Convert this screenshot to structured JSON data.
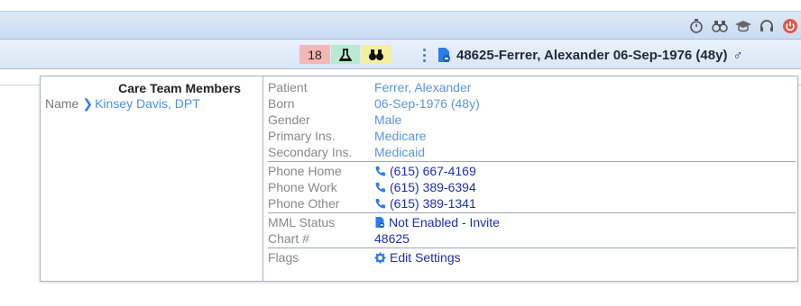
{
  "toolbar": {
    "icons": [
      "stopwatch-icon",
      "binoculars-icon",
      "graduation-cap-icon",
      "headset-icon",
      "power-icon"
    ],
    "power_color": "#e2564a"
  },
  "patient_bar": {
    "count_badge": "18",
    "lab_icon": "flask-icon",
    "binoculars_icon": "binoculars-icon",
    "patient_label": "48625-Ferrer, Alexander 06-Sep-1976 (48y)",
    "gender_symbol": "♂"
  },
  "care_team": {
    "title": "Care Team Members",
    "name_label": "Name",
    "member": "Kinsey Davis, DPT"
  },
  "info": {
    "patient_label": "Patient",
    "patient_value": "Ferrer, Alexander",
    "born_label": "Born",
    "born_value": "06-Sep-1976 (48y)",
    "gender_label": "Gender",
    "gender_value": "Male",
    "primary_label": "Primary Ins.",
    "primary_value": "Medicare",
    "secondary_label": "Secondary Ins.",
    "secondary_value": "Medicaid",
    "phone_home_label": "Phone Home",
    "phone_home_value": "(615) 667-4169",
    "phone_work_label": "Phone Work",
    "phone_work_value": "(615) 389-6394",
    "phone_other_label": "Phone Other",
    "phone_other_value": "(615) 389-1341",
    "mml_label": "MML Status",
    "mml_value": "Not Enabled - Invite",
    "chart_label": "Chart #",
    "chart_value": "48625",
    "flags_label": "Flags",
    "flags_value": "Edit Settings"
  },
  "colors": {
    "link_dark": "#1e2fa8",
    "link_light": "#5b95d9",
    "accent": "#2f7be8"
  }
}
